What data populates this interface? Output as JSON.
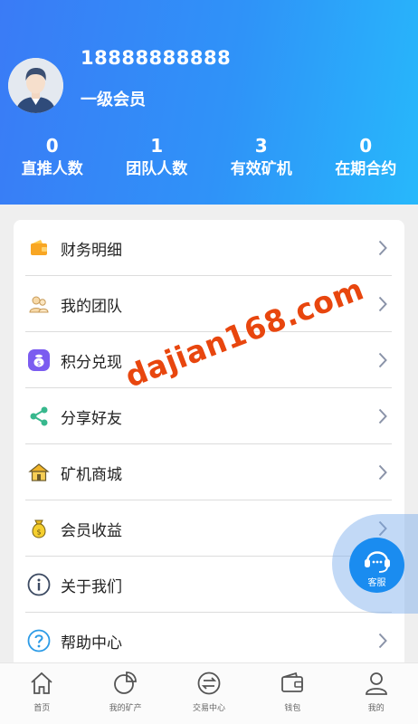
{
  "profile": {
    "phone": "18888888888",
    "level": "一级会员"
  },
  "stats": [
    {
      "value": "0",
      "label": "直推人数"
    },
    {
      "value": "1",
      "label": "团队人数"
    },
    {
      "value": "3",
      "label": "有效矿机"
    },
    {
      "value": "0",
      "label": "在期合约"
    }
  ],
  "menu": [
    {
      "label": "财务明细",
      "icon": "wallet-icon"
    },
    {
      "label": "我的团队",
      "icon": "team-icon"
    },
    {
      "label": "积分兑现",
      "icon": "points-bag-icon"
    },
    {
      "label": "分享好友",
      "icon": "share-icon"
    },
    {
      "label": "矿机商城",
      "icon": "shop-house-icon"
    },
    {
      "label": "会员收益",
      "icon": "money-bag-icon"
    },
    {
      "label": "关于我们",
      "icon": "info-icon"
    },
    {
      "label": "帮助中心",
      "icon": "help-icon"
    }
  ],
  "watermark": "dajian168.com",
  "customer_service": {
    "label": "客服",
    "icon": "headset-icon"
  },
  "tabbar": [
    {
      "label": "首页",
      "icon": "home-icon"
    },
    {
      "label": "我的矿产",
      "icon": "pie-chart-icon"
    },
    {
      "label": "交易中心",
      "icon": "exchange-icon"
    },
    {
      "label": "钱包",
      "icon": "wallet-outline-icon"
    },
    {
      "label": "我的",
      "icon": "user-icon"
    }
  ],
  "colors": {
    "header_start": "#3a7bf6",
    "header_end": "#27b8fb",
    "cs_button": "#1a8cf0",
    "watermark": "#e8460e"
  }
}
